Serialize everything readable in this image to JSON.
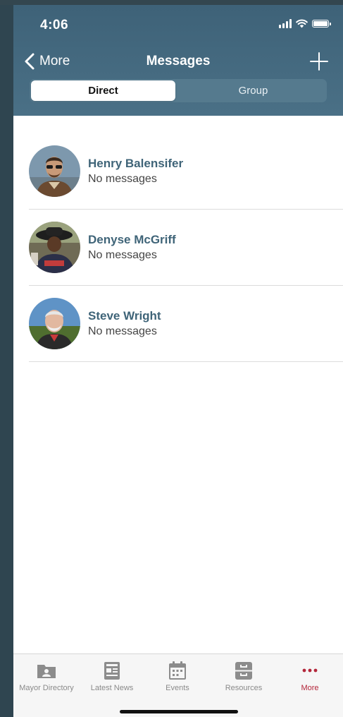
{
  "status_bar": {
    "time": "4:06"
  },
  "nav": {
    "back_label": "More",
    "title": "Messages"
  },
  "segments": {
    "direct": "Direct",
    "group": "Group"
  },
  "contacts": [
    {
      "name": "Henry Balensifer",
      "status": "No messages"
    },
    {
      "name": "Denyse McGriff",
      "status": "No messages"
    },
    {
      "name": "Steve Wright",
      "status": "No messages"
    }
  ],
  "tabs": [
    {
      "label": "Mayor Directory",
      "icon": "folder-user-icon"
    },
    {
      "label": "Latest News",
      "icon": "newspaper-icon"
    },
    {
      "label": "Events",
      "icon": "calendar-icon"
    },
    {
      "label": "Resources",
      "icon": "file-cabinet-icon"
    },
    {
      "label": "More",
      "icon": "more-dots-icon",
      "active": true
    }
  ],
  "colors": {
    "header": "#4a7086",
    "accent_name": "#3f6478",
    "active_tab": "#b3263a"
  }
}
